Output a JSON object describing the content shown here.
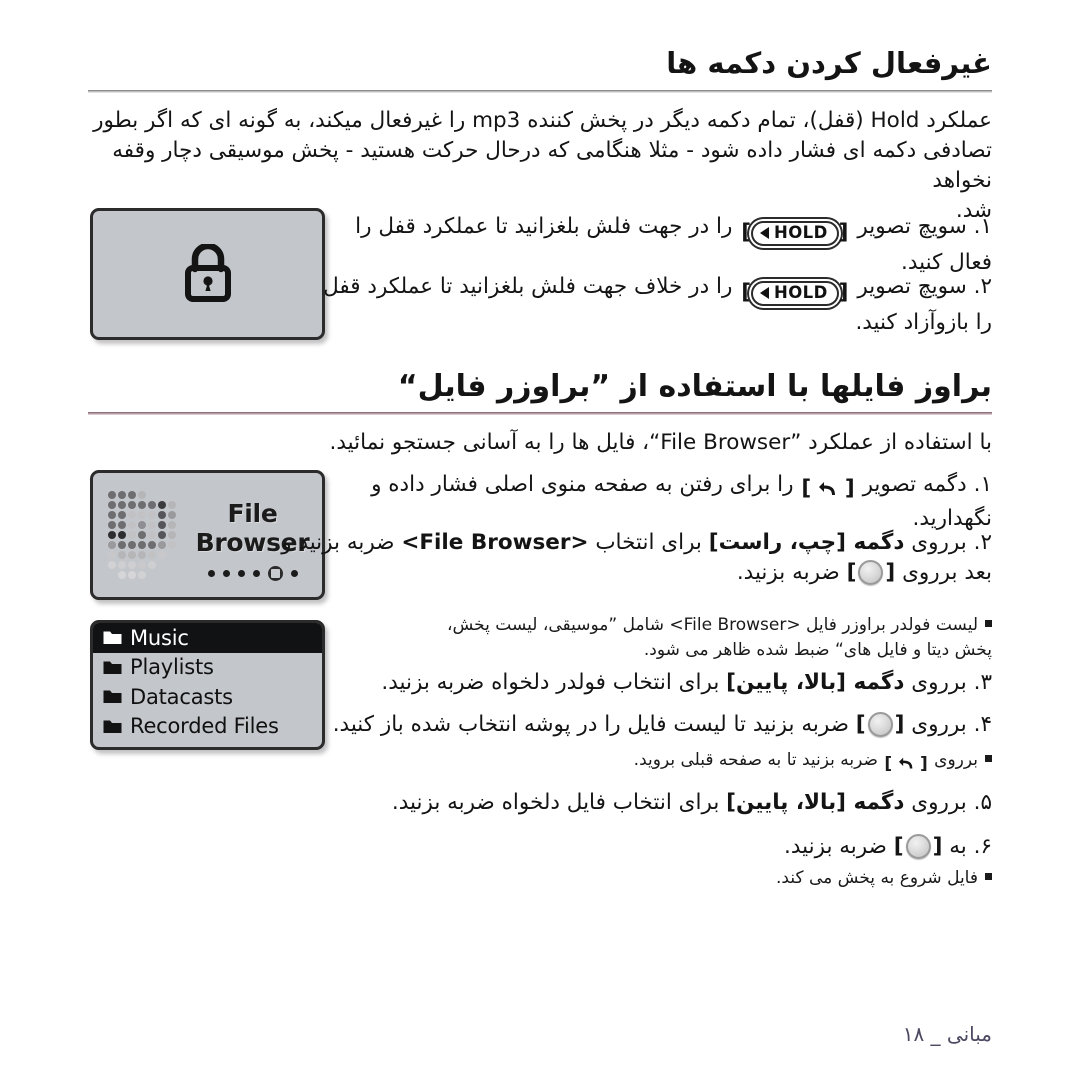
{
  "sections": {
    "lock": {
      "heading": "غیرفعال کردن دکمه ها",
      "intro_line1": "عملکرد Hold (قفل)، تمام دکمه دیگر در پخش کننده mp3 را غیرفعال میکند، به گونه ای که اگر بطور",
      "intro_line2": "تصادفی دکمه ای فشار داده شود - مثلا هنگامی که درحال حرکت هستید - پخش موسیقی دچار وقفه نخواهد",
      "intro_line3": "شد.",
      "screen_label": "lock-screen",
      "steps": [
        {
          "number": "۱.",
          "lead": "سویچ تصویر",
          "key": "HOLD",
          "tail": "را در جهت فلش بلغزانید تا عملکرد قفل را",
          "line2": "فعال کنید."
        },
        {
          "number": "۲.",
          "lead": "سویچ تصویر",
          "key": "HOLD",
          "tail": "را در خلاف جهت فلش بلغزانید تا عملکرد قفل",
          "line2": "را بازوآزاد کنید."
        }
      ]
    },
    "browser": {
      "heading": "براوز فایلها با استفاده از ”براوزر فایل“",
      "intro": "با استفاده از عملکرد ”File Browser“، فایل ها را به آسانی جستجو نمائید.",
      "fb_screen": {
        "title": "File Browser",
        "dots": 5,
        "selected_index": 4
      },
      "menu_screen": {
        "items": [
          {
            "label": "Music",
            "active": true
          },
          {
            "label": "Playlists",
            "active": false
          },
          {
            "label": "Datacasts",
            "active": false
          },
          {
            "label": "Recorded Files",
            "active": false
          }
        ]
      },
      "steps": [
        {
          "number": "۱.",
          "lead": "دگمه تصویر",
          "key": "back-arrow",
          "tail": "را برای رفتن به صفحه منوی اصلی فشار داده و",
          "line2": "نگهدارید."
        },
        {
          "number": "۲.",
          "lead": "برروی",
          "bold": "دگمه [چپ، راست]",
          "mid": "برای انتخاب",
          "target": "<File Browser>",
          "tail": "ضربه بزنید و",
          "line2_lead": "بعد برروی",
          "line2_key": "select-circle",
          "line2_tail": "ضربه بزنید."
        },
        {
          "number": "۳.",
          "lead": "برروی",
          "bold": "دگمه [بالا، پایین]",
          "tail": "برای انتخاب فولدر دلخواه ضربه بزنید."
        },
        {
          "number": "۴.",
          "lead": "برروی",
          "key": "select-circle",
          "tail": "ضربه بزنید تا لیست فایل را در پوشه انتخاب شده باز کنید."
        },
        {
          "number": "۵.",
          "lead": "برروی",
          "bold": "دگمه [بالا، پایین]",
          "tail": "برای انتخاب فایل دلخواه ضربه بزنید."
        },
        {
          "number": "۶.",
          "lead": "به",
          "key": "select-circle",
          "tail": "ضربه بزنید."
        }
      ],
      "notes": [
        {
          "line1": "لیست فولدر براوزر فایل <File Browser> شامل ”موسیقی، لیست پخش،",
          "line2": "پخش دیتا و فایل های“ ضبط شده ظاهر می شود."
        },
        {
          "line1": "برروی",
          "key": "back-arrow",
          "line1_tail": "ضربه بزنید تا به صفحه قبلی بروید."
        },
        {
          "line1": "فایل شروع به پخش می کند."
        }
      ]
    }
  },
  "footer": {
    "text": "مبانی _ ۱۸",
    "color": "#4c4a62"
  },
  "colors": {
    "rule_grey": "#8d8d8d",
    "rule_mauve": "#8a7278",
    "screen_bg": "#c3c6cb",
    "screen_border": "#2b2b2b",
    "menu_active_bg": "#111214",
    "text": "#141414"
  }
}
